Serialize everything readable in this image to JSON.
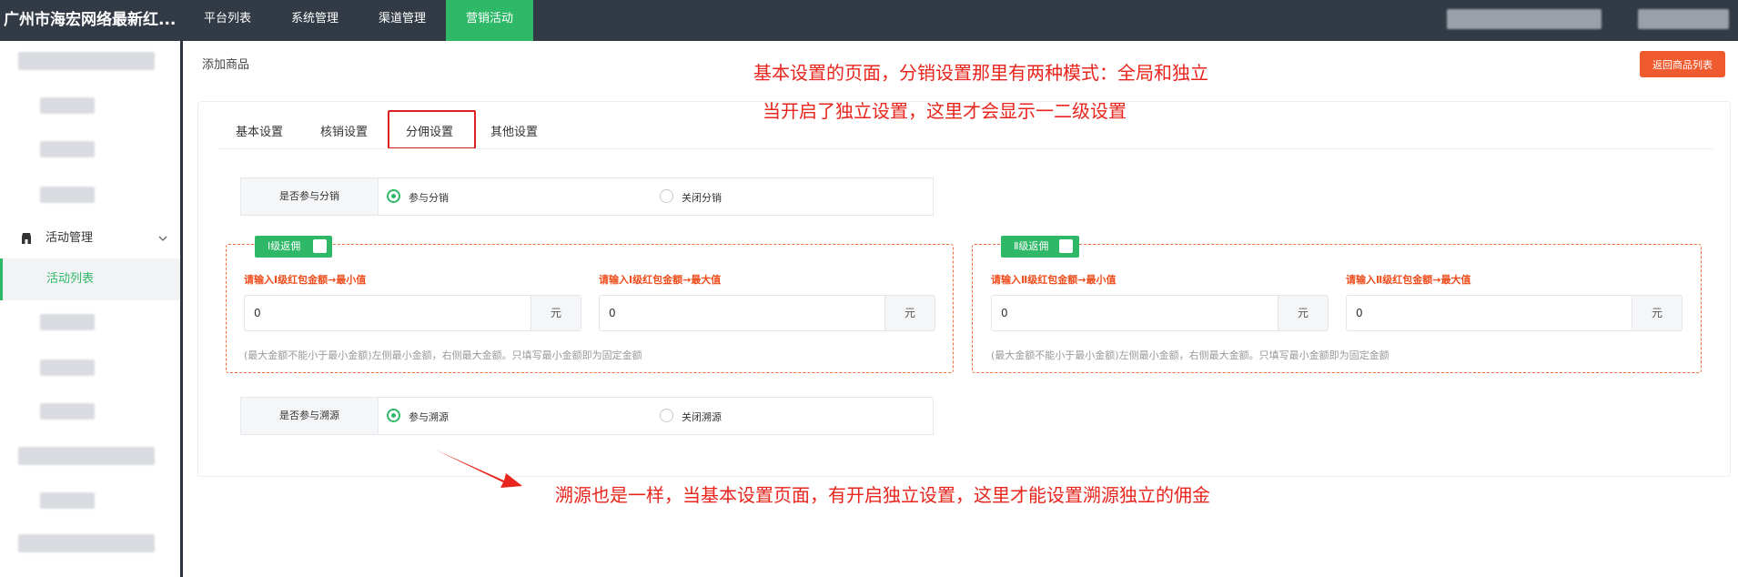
{
  "app": {
    "title": "广州市海宏网络最新红..."
  },
  "nav": {
    "tabs": [
      "平台列表",
      "系统管理",
      "渠道管理",
      "营销活动"
    ],
    "active": "营销活动"
  },
  "sidebar": {
    "group_label": "活动管理",
    "active_item": "活动列表"
  },
  "page": {
    "breadcrumb": "添加商品",
    "back_button": "返回商品列表"
  },
  "tabs": [
    "基本设置",
    "核销设置",
    "分佣设置",
    "其他设置"
  ],
  "distribution": {
    "label": "是否参与分销",
    "options": [
      "参与分销",
      "关闭分销"
    ],
    "selected": "参与分销"
  },
  "level1": {
    "badge": "Ⅰ级返佣",
    "min_label": "请输入Ⅰ级红包金额→最小值",
    "max_label": "请输入Ⅰ级红包金额→最大值",
    "min_value": "0",
    "max_value": "0",
    "unit": "元",
    "hint": "(最大金额不能小于最小金额)左侧最小金额，右侧最大金额。只填写最小金额即为固定金额"
  },
  "level2": {
    "badge": "Ⅱ级返佣",
    "min_label": "请输入Ⅱ级红包金额→最小值",
    "max_label": "请输入Ⅱ级红包金额→最大值",
    "min_value": "0",
    "max_value": "0",
    "unit": "元",
    "hint": "(最大金额不能小于最小金额)左侧最小金额，右侧最大金额。只填写最小金额即为固定金额"
  },
  "traceability": {
    "label": "是否参与溯源",
    "options": [
      "参与溯源",
      "关闭溯源"
    ],
    "selected": "参与溯源"
  },
  "annotations": {
    "line1": "基本设置的页面，分销设置那里有两种模式：全局和独立",
    "line2": "当开启了独立设置，这里才会显示一二级设置",
    "line3": "溯源也是一样，当基本设置页面，有开启独立设置，这里才能设置溯源独立的佣金"
  },
  "colors": {
    "topbar": "#323a45",
    "accent": "#2fb868",
    "danger": "#f05a2f",
    "annotation": "#e8241c"
  }
}
